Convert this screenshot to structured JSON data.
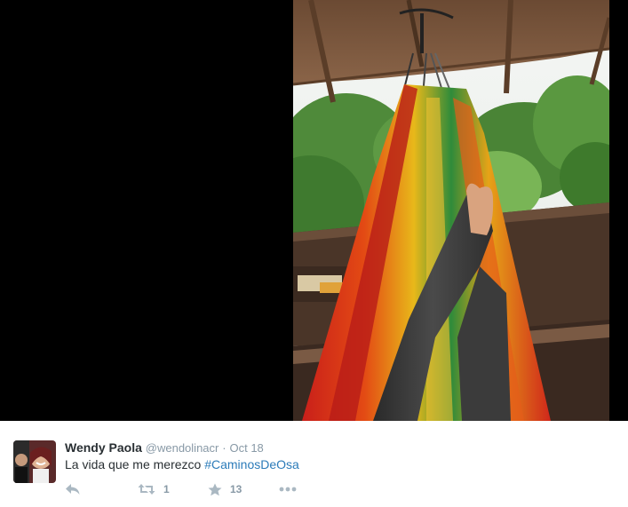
{
  "media": {
    "alt_icon": "hammock-photo"
  },
  "tweet": {
    "fullname": "Wendy Paola",
    "screenname": "@wendolinacr",
    "separator": "·",
    "timestamp": "Oct 18",
    "text_plain": "La vida que me merezco ",
    "hashtag": "#CaminosDeOsa",
    "avatar_icon": "user-avatar",
    "actions": {
      "reply_icon": "reply-icon",
      "retweet_icon": "retweet-icon",
      "retweet_count": "1",
      "favorite_icon": "star-icon",
      "favorite_count": "13",
      "more_icon": "more-dots-icon"
    }
  },
  "colors": {
    "link": "#2b7bb9",
    "muted": "#8899a6",
    "text": "#292f33",
    "media_bg": "#000000"
  }
}
